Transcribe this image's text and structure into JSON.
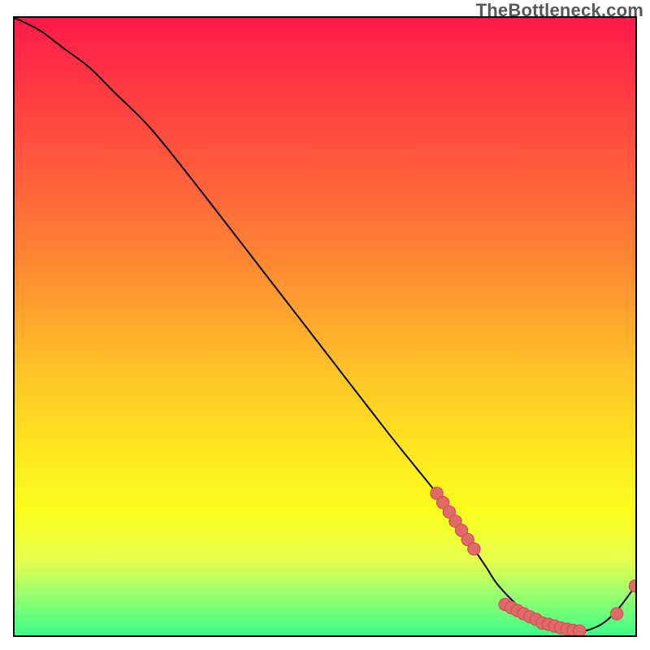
{
  "watermark": "TheBottleneck.com",
  "colors": {
    "curve_stroke": "#000000",
    "marker_fill": "#e06a6a",
    "marker_stroke": "#d24f4f"
  },
  "chart_data": {
    "type": "line",
    "title": "",
    "xlabel": "",
    "ylabel": "",
    "xlim": [
      0,
      100
    ],
    "ylim": [
      0,
      100
    ],
    "grid": false,
    "legend": false,
    "series": [
      {
        "name": "curve",
        "x": [
          0,
          4,
          8,
          12,
          16,
          22,
          30,
          40,
          50,
          60,
          68,
          70,
          72,
          74,
          76,
          78,
          82,
          86,
          90,
          94,
          97,
          100
        ],
        "y": [
          100,
          98,
          95,
          92,
          88,
          82,
          72,
          59,
          46,
          33,
          23,
          20,
          17,
          14,
          11,
          8,
          4,
          1.5,
          0.5,
          1.5,
          4,
          8
        ]
      }
    ],
    "markers": [
      {
        "x": 68,
        "y": 23
      },
      {
        "x": 69,
        "y": 21.5
      },
      {
        "x": 70,
        "y": 20
      },
      {
        "x": 71,
        "y": 18.5
      },
      {
        "x": 72,
        "y": 17
      },
      {
        "x": 73,
        "y": 15.5
      },
      {
        "x": 74,
        "y": 14
      },
      {
        "x": 79,
        "y": 5
      },
      {
        "x": 80,
        "y": 4.5
      },
      {
        "x": 81,
        "y": 4
      },
      {
        "x": 82,
        "y": 3.5
      },
      {
        "x": 83,
        "y": 3
      },
      {
        "x": 84,
        "y": 2.6
      },
      {
        "x": 85,
        "y": 2
      },
      {
        "x": 86,
        "y": 1.8
      },
      {
        "x": 87,
        "y": 1.5
      },
      {
        "x": 88,
        "y": 1.2
      },
      {
        "x": 89,
        "y": 1
      },
      {
        "x": 90,
        "y": 0.8
      },
      {
        "x": 91,
        "y": 0.7
      },
      {
        "x": 97,
        "y": 3.5
      },
      {
        "x": 100,
        "y": 8
      }
    ]
  }
}
